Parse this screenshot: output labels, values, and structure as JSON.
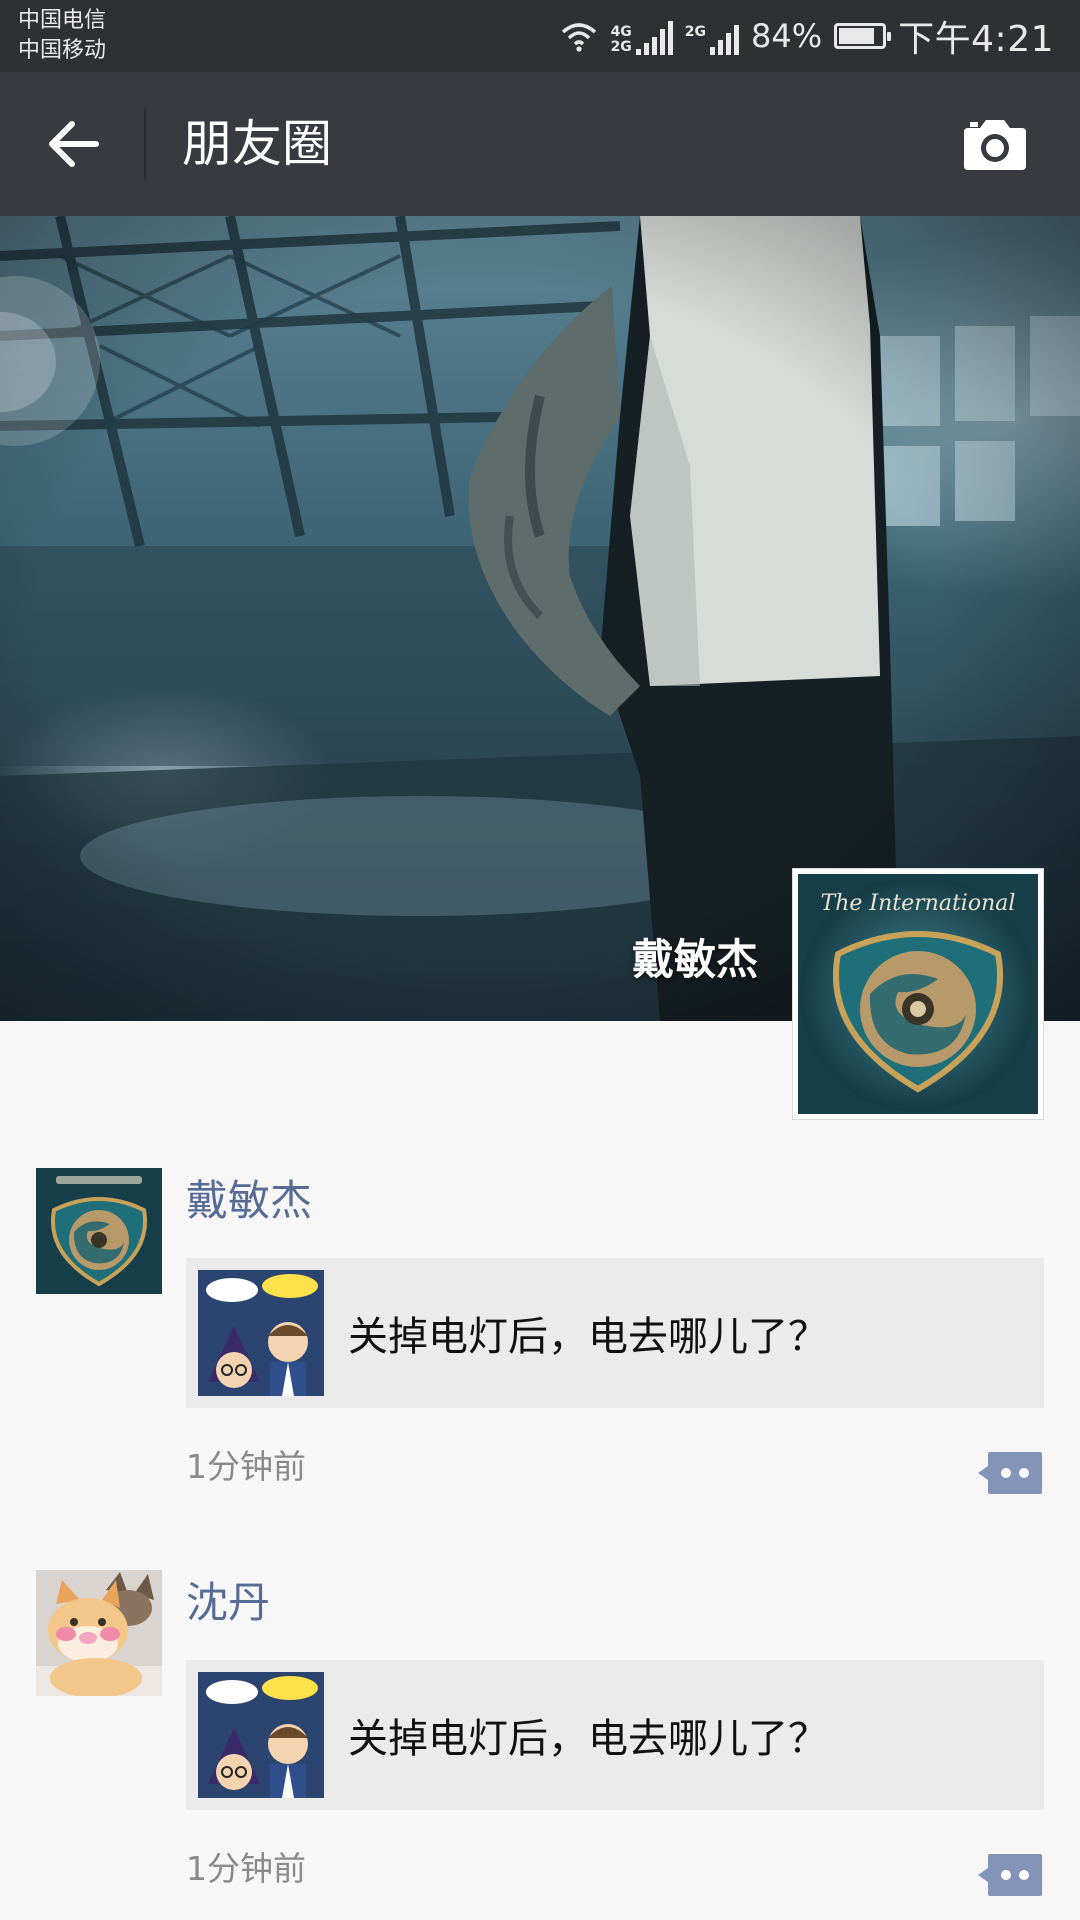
{
  "status_bar": {
    "carrier_1": "中国电信",
    "carrier_2": "中国移动",
    "network_tag_top": "4G",
    "network_tag_bottom": "2G",
    "network_tag_2": "2G",
    "battery_percent": "84%",
    "battery_level": 0.84,
    "time": "下午4:21"
  },
  "nav": {
    "title": "朋友圈",
    "back_icon": "arrow-left-icon",
    "camera_icon": "camera-icon"
  },
  "profile": {
    "name": "戴敏杰",
    "avatar_caption": "The International"
  },
  "posts": [
    {
      "author": "戴敏杰",
      "share_title": "关掉电灯后，电去哪儿了？",
      "time": "1分钟前"
    },
    {
      "author": "沈丹",
      "share_title": "关掉电灯后，电去哪儿了？",
      "time": "1分钟前"
    }
  ],
  "colors": {
    "status_bar": "#2f3033",
    "nav_bar": "#393a3f",
    "author_name": "#576b95",
    "card_bg": "#ebebeb",
    "feed_bg": "#f7f7f7",
    "comment_icon": "#8494b8"
  }
}
